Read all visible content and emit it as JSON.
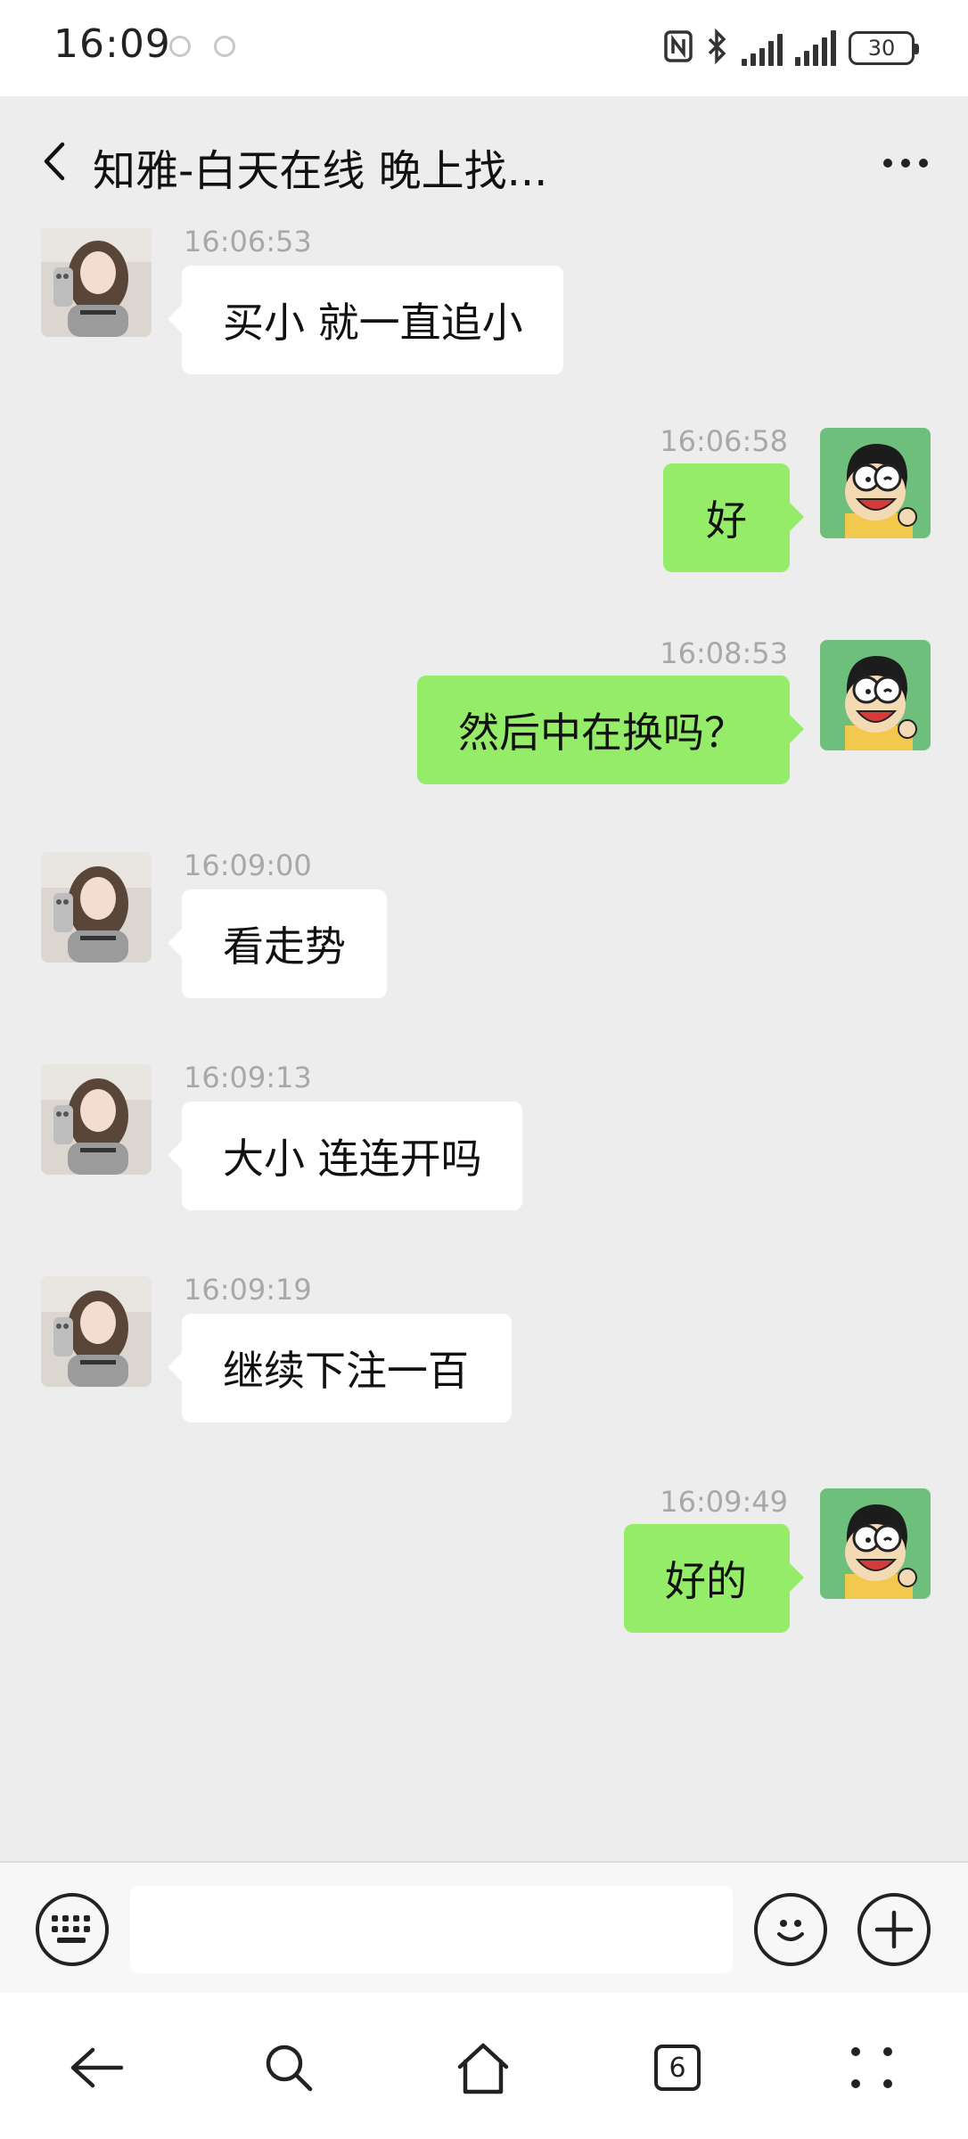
{
  "status_bar": {
    "time": "16:09",
    "battery": "30",
    "icons": [
      "nfc-icon",
      "bluetooth-icon",
      "signal-icon",
      "signal-icon",
      "battery-icon"
    ]
  },
  "header": {
    "title": "知雅-白天在线 晚上找...",
    "back_icon": "back-arrow-icon",
    "more_icon": "more-dots-icon"
  },
  "messages": [
    {
      "side": "in",
      "time": "16:06:53",
      "text": "买小 就一直追小"
    },
    {
      "side": "out",
      "time": "16:06:58",
      "text": "好"
    },
    {
      "side": "out",
      "time": "16:08:53",
      "text": "然后中在换吗？"
    },
    {
      "side": "in",
      "time": "16:09:00",
      "text": "看走势"
    },
    {
      "side": "in",
      "time": "16:09:13",
      "text": "大小 连连开吗"
    },
    {
      "side": "in",
      "time": "16:09:19",
      "text": "继续下注一百"
    },
    {
      "side": "out",
      "time": "16:09:49",
      "text": "好的"
    }
  ],
  "input_bar": {
    "text_value": "",
    "left_icon": "keyboard-icon",
    "right_icons": [
      "emoji-icon",
      "plus-icon"
    ]
  },
  "system_nav": {
    "tab_count": "6",
    "icons": [
      "back-icon",
      "search-icon",
      "home-icon",
      "tabs-icon",
      "menu-icon"
    ]
  },
  "colors": {
    "background": "#ededed",
    "incoming_bubble": "#ffffff",
    "outgoing_bubble": "#95ec69",
    "timestamp": "#a8a8a8"
  }
}
